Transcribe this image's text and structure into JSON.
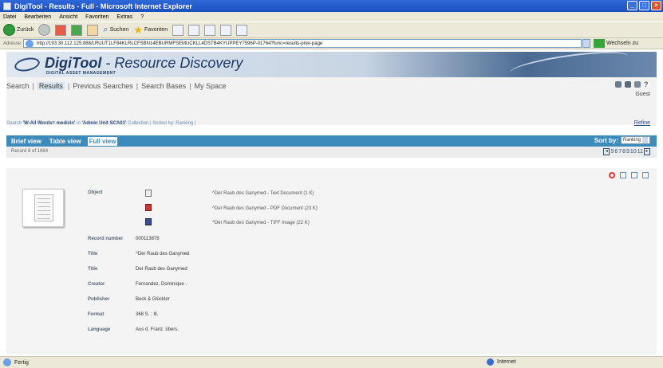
{
  "window": {
    "title": "DigiTool - Results - Full - Microsoft Internet Explorer"
  },
  "menu": [
    "Datei",
    "Bearbeiten",
    "Ansicht",
    "Favoriten",
    "Extras",
    "?"
  ],
  "toolbar": {
    "back_label": "Zurück",
    "search_label": "Suchen",
    "favorites_label": "Favoriten"
  },
  "address": {
    "label": "Adresse",
    "url": "http://193.30.112.125:888/LRUUT1LF84KLRLCFSBN14EBURMFSEMUCKLL4DSTB4KYUPPEY7596P-01764?func=results-prev-page",
    "go_label": "Wechseln zu"
  },
  "brand": {
    "name": "DigiTool",
    "tagline": " - Resource Discovery",
    "subtitle": "DIGITAL ASSET MANAGEMENT"
  },
  "nav": {
    "items": [
      "Search",
      "Results",
      "Previous Searches",
      "Search Bases",
      "My Space"
    ],
    "user": "Guest"
  },
  "search_info": {
    "prefix": "Search ",
    "query": "'W-All Words= medizin'",
    "in": " in ",
    "collection": "'Admin Unit SCA01'",
    "suffix": " Collection | Sorted by: Ranking |",
    "refine": "Refine"
  },
  "views": {
    "tabs": [
      "Brief view",
      "Table view",
      "Full view"
    ],
    "active": "Full view"
  },
  "sort": {
    "label": "Sort by:",
    "value": "Ranking"
  },
  "record": {
    "position": "Record 8 of 1884",
    "pages": [
      "5",
      "6",
      "7",
      "8",
      "9",
      "10",
      "11"
    ]
  },
  "objects": [
    {
      "label": "^Der Raub des Ganymed - Text Document (1 K)",
      "icon": "text-document-icon"
    },
    {
      "label": "^Der Raub des Ganymed - PDF Document (23 K)",
      "icon": "pdf-document-icon"
    },
    {
      "label": "^Der Raub des Ganymed - TIFF Image (22 K)",
      "icon": "tiff-image-icon"
    }
  ],
  "fields": {
    "object_label": "Object",
    "record_number_label": "Record number",
    "record_number": "000113878",
    "title_label": "Title",
    "title_1": "^Der Raub des Ganymed",
    "title_2": "Der Raub des Ganymed",
    "creator_label": "Creator",
    "creator": "Fernandez, Dominique .",
    "publisher_label": "Publisher",
    "publisher": "Beck & Glückler",
    "format_label": "Format",
    "format": "368 S. : Ill.",
    "language_label": "Language",
    "language": "Aus d. Franz. übers."
  },
  "status": {
    "text": "Fertig",
    "zone": "Internet"
  },
  "colors": {
    "tab_bar": "#3d8bbd",
    "title_bar": "#1b4fc0",
    "brand": "#1e3b66"
  }
}
